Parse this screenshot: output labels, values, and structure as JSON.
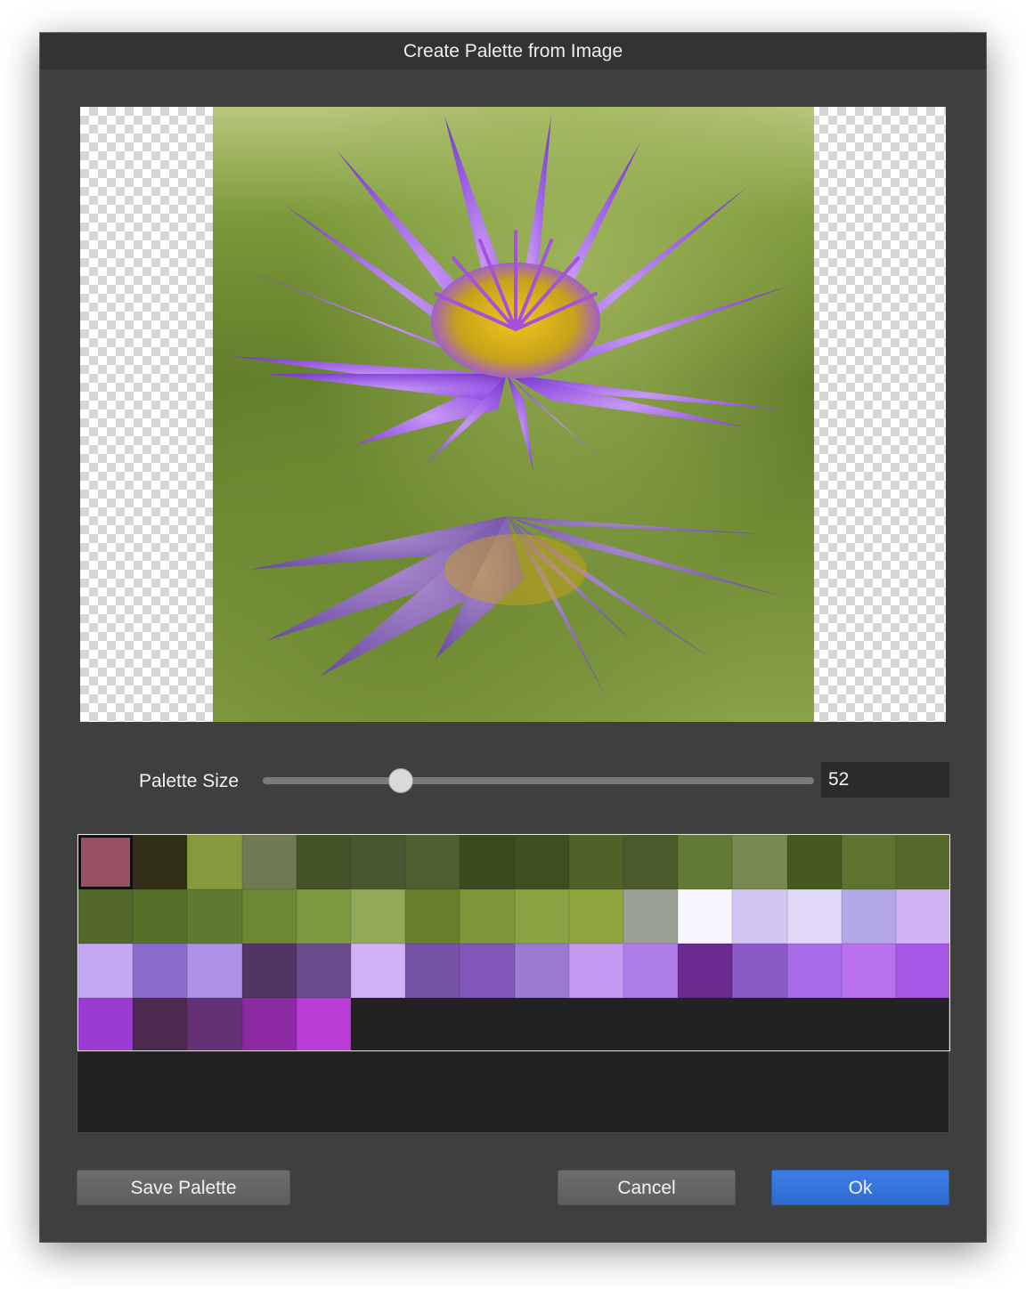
{
  "dialog": {
    "title": "Create Palette from Image"
  },
  "preview": {
    "image": "water-lily-photo"
  },
  "palette_size": {
    "label": "Palette Size",
    "value": "52",
    "slider_fraction": 0.25
  },
  "swatches": [
    "#9b5063",
    "#313016",
    "#869a3d",
    "#6d7a52",
    "#435327",
    "#485730",
    "#4e5f32",
    "#3c4a1f",
    "#3f4f22",
    "#4f6229",
    "#4b5a2a",
    "#617a35",
    "#768a52",
    "#455a22",
    "#5d7430",
    "#55692a",
    "#52682a",
    "#56702a",
    "#5f7a2e",
    "#6c8833",
    "#7b9a40",
    "#91aa58",
    "#687f2c",
    "#7f963b",
    "#8aa242",
    "#8ea43c",
    "#9aa194",
    "#f7f6fe",
    "#d4c6f2",
    "#e1d7f7",
    "#b3a7e8",
    "#cfb3f3",
    "#c3a8f2",
    "#8a6ccc",
    "#ac91e5",
    "#523563",
    "#6b4b8d",
    "#d1b0f6",
    "#7753a5",
    "#8158ba",
    "#9b7ad2",
    "#c29af2",
    "#ae7de9",
    "#6a2a8e",
    "#8a5bc6",
    "#a66ce7",
    "#b971ef",
    "#a458e3",
    "#9a3bd2",
    "#4c2a4e",
    "#643274",
    "#8c2aa4",
    "#bb3cd6"
  ],
  "buttons": {
    "save": "Save Palette",
    "cancel": "Cancel",
    "ok": "Ok"
  },
  "colors": {
    "accent": "#3172db",
    "dialog_bg": "#3f3f3f"
  }
}
